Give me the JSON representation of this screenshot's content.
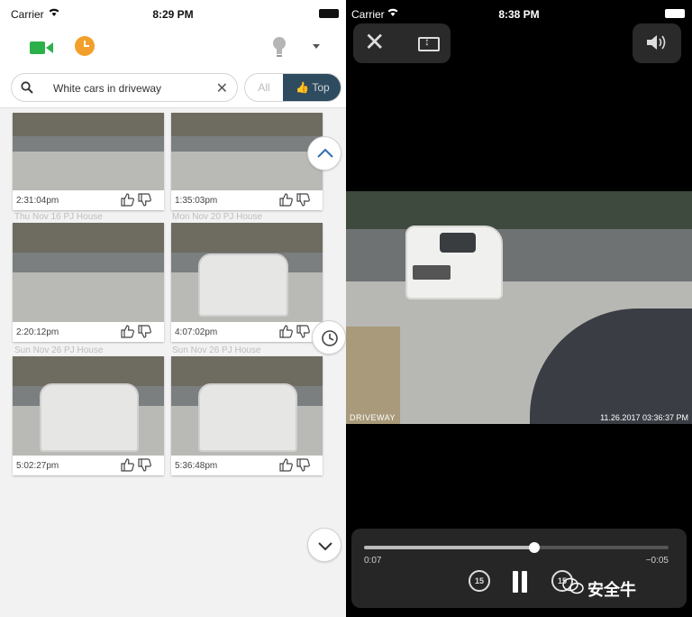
{
  "left": {
    "status": {
      "carrier": "Carrier",
      "time": "8:29 PM"
    },
    "search": {
      "query": "White cars in driveway"
    },
    "filter": {
      "all": "All",
      "top": "Top",
      "selected": "Top"
    },
    "cards": [
      {
        "time": "2:31:04pm",
        "caption_below": "Thu Nov 16  PJ House"
      },
      {
        "time": "1:35:03pm",
        "caption_below": "Mon Nov 20  PJ House"
      },
      {
        "time": "2:20:12pm",
        "caption_below": "Sun Nov 26  PJ House"
      },
      {
        "time": "4:07:02pm",
        "caption_below": "Sun Nov 26  PJ House"
      },
      {
        "time": "5:02:27pm",
        "caption_below": ""
      },
      {
        "time": "5:36:48pm",
        "caption_below": ""
      }
    ]
  },
  "right": {
    "status": {
      "carrier": "Carrier",
      "time": "8:38 PM"
    },
    "video": {
      "camera_label": "DRIVEWAY",
      "timestamp": "11.26.2017 03:36:37 PM"
    },
    "player": {
      "elapsed": "0:07",
      "remaining": "−0:05",
      "progress": 0.56,
      "skip_back": "15",
      "skip_fwd": "15"
    },
    "watermark": "安全牛"
  },
  "colors": {
    "accent_green": "#2bb04a",
    "accent_orange": "#f2a02b",
    "segment_active": "#2f4b5f"
  },
  "icons": [
    "video-camera-icon",
    "clock-icon",
    "lightbulb-icon",
    "chevron-down-icon",
    "search-icon",
    "clear-icon",
    "thumbs-up-icon",
    "thumbs-down-icon",
    "chevron-up-icon",
    "history-icon",
    "close-icon",
    "fit-screen-icon",
    "volume-icon",
    "skip-back-15-icon",
    "pause-icon",
    "skip-forward-15-icon"
  ]
}
